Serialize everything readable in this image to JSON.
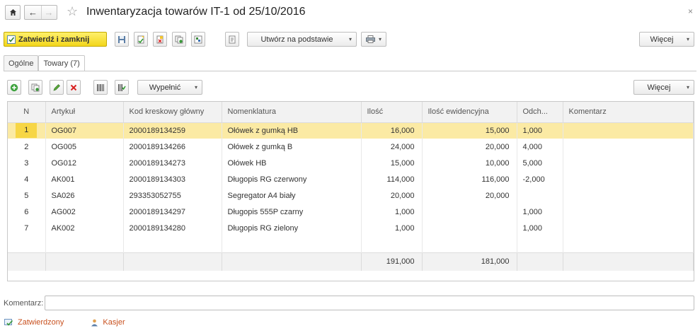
{
  "window": {
    "title": "Inwentaryzacja towarów IT-1 od 25/10/2016",
    "close_glyph": "×"
  },
  "toolbar": {
    "approve_close_label": "Zatwierdź i zamknij",
    "create_based_on_label": "Utwórz na podstawie",
    "more_label": "Więcej"
  },
  "tabs": [
    {
      "label": "Ogólne",
      "active": false
    },
    {
      "label": "Towary (7)",
      "active": true
    }
  ],
  "grid_toolbar": {
    "fill_label": "Wypełnić",
    "more_label": "Więcej"
  },
  "grid": {
    "columns": [
      "N",
      "Artykuł",
      "Kod kreskowy główny",
      "Nomenklatura",
      "Ilość",
      "Ilość ewidencyjna",
      "Odch...",
      "Komentarz"
    ],
    "rows": [
      {
        "n": "1",
        "article": "OG007",
        "barcode": "2000189134259",
        "item": "Ołówek z gumką HB",
        "qty": "16,000",
        "book_qty": "15,000",
        "dev": "1,000",
        "comment": ""
      },
      {
        "n": "2",
        "article": "OG005",
        "barcode": "2000189134266",
        "item": "Ołówek z gumką B",
        "qty": "24,000",
        "book_qty": "20,000",
        "dev": "4,000",
        "comment": ""
      },
      {
        "n": "3",
        "article": "OG012",
        "barcode": "2000189134273",
        "item": "Ołówek HB",
        "qty": "15,000",
        "book_qty": "10,000",
        "dev": "5,000",
        "comment": ""
      },
      {
        "n": "4",
        "article": "AK001",
        "barcode": "2000189134303",
        "item": "Długopis RG czerwony",
        "qty": "114,000",
        "book_qty": "116,000",
        "dev": "-2,000",
        "comment": ""
      },
      {
        "n": "5",
        "article": "SA026",
        "barcode": "293353052755",
        "item": "Segregator A4 biały",
        "qty": "20,000",
        "book_qty": "20,000",
        "dev": "",
        "comment": ""
      },
      {
        "n": "6",
        "article": "AG002",
        "barcode": "2000189134297",
        "item": "Długopis 555P czarny",
        "qty": "1,000",
        "book_qty": "",
        "dev": "1,000",
        "comment": ""
      },
      {
        "n": "7",
        "article": "AK002",
        "barcode": "2000189134280",
        "item": "Długopis RG zielony",
        "qty": "1,000",
        "book_qty": "",
        "dev": "1,000",
        "comment": ""
      }
    ],
    "totals": {
      "qty": "191,000",
      "book_qty": "181,000"
    },
    "selected_row": 0
  },
  "comment": {
    "label": "Komentarz:",
    "value": ""
  },
  "status": {
    "state_label": "Zatwierdzony",
    "user_label": "Kasjer"
  },
  "colors": {
    "accent_yellow": "#f2d61c",
    "selected_row": "#fbeaa4",
    "positive": "#2a9a2a",
    "negative": "#d21c1c"
  }
}
